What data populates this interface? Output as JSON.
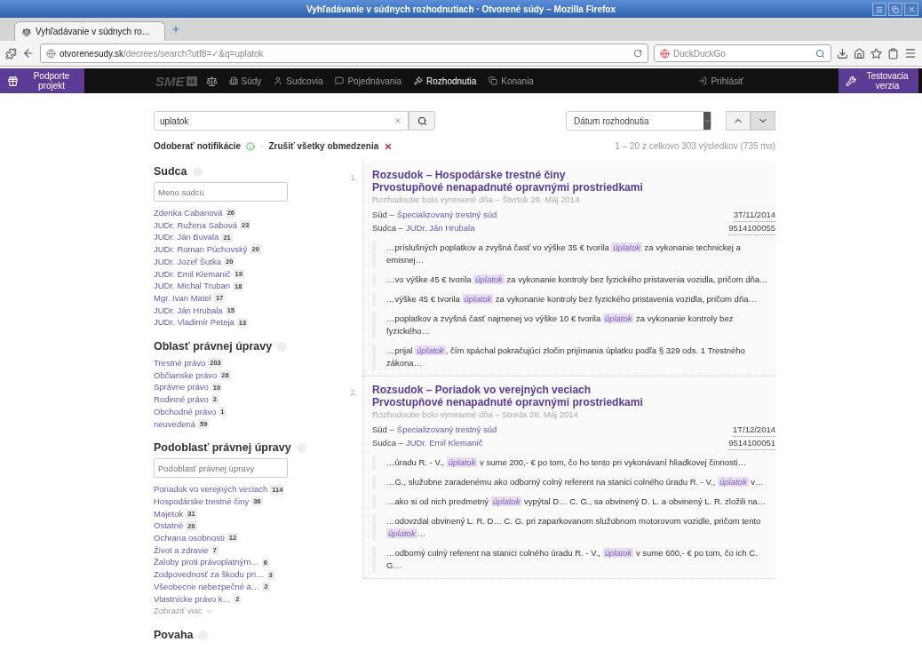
{
  "window": {
    "title": "Vyhľadávanie v súdnych rozhodnutiach · Otvorené súdy – Mozilla Firefox"
  },
  "tabs": [
    {
      "label": "Vyhľadávanie v súdnych ro...",
      "selected": true
    }
  ],
  "address": {
    "domain": "otvorenesudy.sk",
    "path": "/decrees/search?utf8=✓&q=uplatok"
  },
  "browser_search": {
    "placeholder": "DuckDuckGo"
  },
  "site_nav": {
    "support": "Podporte projekt",
    "logo": "SME",
    "logo_badge": "sk",
    "items": [
      {
        "label": "Súdy",
        "selected": false
      },
      {
        "label": "Sudcovia",
        "selected": false
      },
      {
        "label": "Pojednávania",
        "selected": false
      },
      {
        "label": "Rozhodnutia",
        "selected": true
      },
      {
        "label": "Konania",
        "selected": false
      }
    ],
    "login": "Prihlásiť",
    "beta": "Testovacia verzia"
  },
  "search": {
    "value": "uplatok",
    "sort": "Dátum rozhodnutia",
    "order_desc": true
  },
  "filters_bar": {
    "subscribe": "Odoberať notifikácie",
    "separator": "·",
    "clear": "Zrušiť všetky obmedzenia",
    "count": "1 – 20 z celkovo 303 výsledkov (735 ms)"
  },
  "facets": [
    {
      "title": "Sudca",
      "placeholder": "Meno sudcu",
      "items": [
        {
          "label": "Zdenka Cabanová",
          "count": "26"
        },
        {
          "label": "JUDr. Ružena Sabová",
          "count": "23"
        },
        {
          "label": "JUDr. Ján Buvala",
          "count": "21"
        },
        {
          "label": "JUDr. Roman Púchovský",
          "count": "20"
        },
        {
          "label": "JUDr. Jozef Šutka",
          "count": "20"
        },
        {
          "label": "JUDr. Emil Klemanič",
          "count": "19"
        },
        {
          "label": "JUDr. Michal Truban",
          "count": "18"
        },
        {
          "label": "Mgr. Ivan Matel",
          "count": "17"
        },
        {
          "label": "JUDr. Ján Hrubala",
          "count": "15"
        },
        {
          "label": "JUDr. Vladimír Peteja",
          "count": "13"
        }
      ]
    },
    {
      "title": "Oblasť právnej úpravy",
      "items": [
        {
          "label": "Trestné právo",
          "count": "203"
        },
        {
          "label": "Občianske právo",
          "count": "28"
        },
        {
          "label": "Správne právo",
          "count": "10"
        },
        {
          "label": "Rodinné právo",
          "count": "2"
        },
        {
          "label": "Obchodné právo",
          "count": "1"
        },
        {
          "label": "neuvedená",
          "count": "59"
        }
      ]
    },
    {
      "title": "Podoblasť právnej úpravy",
      "placeholder": "Podoblasť právnej úpravy",
      "items": [
        {
          "label": "Poriadok vo verejných veciach",
          "count": "114"
        },
        {
          "label": "Hospodárske trestné činy",
          "count": "36"
        },
        {
          "label": "Majetok",
          "count": "31"
        },
        {
          "label": "Ostatné",
          "count": "20"
        },
        {
          "label": "Ochrana osobnosti",
          "count": "12"
        },
        {
          "label": "Život a zdravie",
          "count": "7"
        },
        {
          "label": "Žaloby proti právoplatným…",
          "count": "6"
        },
        {
          "label": "Zodpovednosť za škodu pri…",
          "count": "3"
        },
        {
          "label": "Všeobecne nebezpečné a…",
          "count": "2"
        },
        {
          "label": "Vlastnícke právo k…",
          "count": "2"
        }
      ],
      "more": "Zobraziť viac"
    },
    {
      "title": "Povaha"
    }
  ],
  "results": [
    {
      "number": "1.",
      "title": "Rozsudok – Hospodárske trestné činy",
      "subtitle": "Prvostupňové nenapadnuté opravnými prostriedkami",
      "date": "Rozhodnutie bolo vynesené dňa – Štvrtok 29. Máj 2014",
      "court_label": "Súd –",
      "court": "Špecializovaný trestný súd",
      "judge_label": "Sudca –",
      "judge": "JUDr. Ján Hrubala",
      "file": "3T/11/2014",
      "ecli": "9514100055",
      "snippets": [
        [
          {
            "kind": "text",
            "text": "…príslušných poplatkov a zvyšná časť vo výške 35 € tvorila "
          },
          {
            "kind": "highlight",
            "text": "úplatok"
          },
          {
            "kind": "text",
            "text": " za vykonanie technickej a emisnej…"
          }
        ],
        [
          {
            "kind": "text",
            "text": "…vo výške 45 € tvorila "
          },
          {
            "kind": "highlight",
            "text": "úplatok"
          },
          {
            "kind": "text",
            "text": " za vykonanie kontroly bez fyzického pristavenia vozidla, pričom dňa…"
          }
        ],
        [
          {
            "kind": "text",
            "text": "…výške 45 € tvorila "
          },
          {
            "kind": "highlight",
            "text": "úplatok"
          },
          {
            "kind": "text",
            "text": " za vykonanie kontroly bez fyzického pristavenia vozidla, pričom dňa…"
          }
        ],
        [
          {
            "kind": "text",
            "text": "…poplatkov a zvyšná časť najmenej vo výške 10 € tvorila "
          },
          {
            "kind": "highlight",
            "text": "úplatok"
          },
          {
            "kind": "text",
            "text": " za vykonanie kontroly bez fyzického…"
          }
        ],
        [
          {
            "kind": "text",
            "text": "…prijal "
          },
          {
            "kind": "highlight",
            "text": "úplatok"
          },
          {
            "kind": "text",
            "text": ", čím spáchal pokračujúci zločin prijímania úplatku podľa § 329 ods. 1 Trestného zákona…"
          }
        ]
      ]
    },
    {
      "number": "2.",
      "title": "Rozsudok – Poriadok vo verejných veciach",
      "subtitle": "Prvostupňové nenapadnuté opravnými prostriedkami",
      "date": "Rozhodnutie bolo vynesené dňa – Streda 28. Máj 2014",
      "court_label": "Súd –",
      "court": "Špecializovaný trestný súd",
      "judge_label": "Sudca –",
      "judge": "JUDr. Emil Klemanič",
      "file": "1T/12/2014",
      "ecli": "9514100051",
      "snippets": [
        [
          {
            "kind": "text",
            "text": "…úradu R. - V., "
          },
          {
            "kind": "highlight",
            "text": "úplatok"
          },
          {
            "kind": "text",
            "text": " v sume 200,- € po tom, čo ho tento pri vykonávaní hliadkovej činnosti…"
          }
        ],
        [
          {
            "kind": "text",
            "text": "…G., služobne zaradenému ako odborný colný referent na stanici colného úradu R. - V., "
          },
          {
            "kind": "highlight",
            "text": "úplatok"
          },
          {
            "kind": "text",
            "text": " v…"
          }
        ],
        [
          {
            "kind": "text",
            "text": "…ako si od nich predmetný "
          },
          {
            "kind": "highlight",
            "text": "úplatok"
          },
          {
            "kind": "text",
            "text": " vypýtal D… C. G., sa obvinený D. L. a obvinený L. R. zložili na…"
          }
        ],
        [
          {
            "kind": "text",
            "text": "…odovzdal obvinený L. R. D… C. G. pri zaparkovanom služobnom motorovom vozidle, pričom tento "
          },
          {
            "kind": "highlight",
            "text": "úplatok"
          },
          {
            "kind": "text",
            "text": "…"
          }
        ],
        [
          {
            "kind": "text",
            "text": "…odborný colný referent na stanici colného úradu R. - V., "
          },
          {
            "kind": "highlight",
            "text": "úplatok"
          },
          {
            "kind": "text",
            "text": " v sume 600,- € po tom, čo ich C. G…"
          }
        ]
      ]
    }
  ]
}
